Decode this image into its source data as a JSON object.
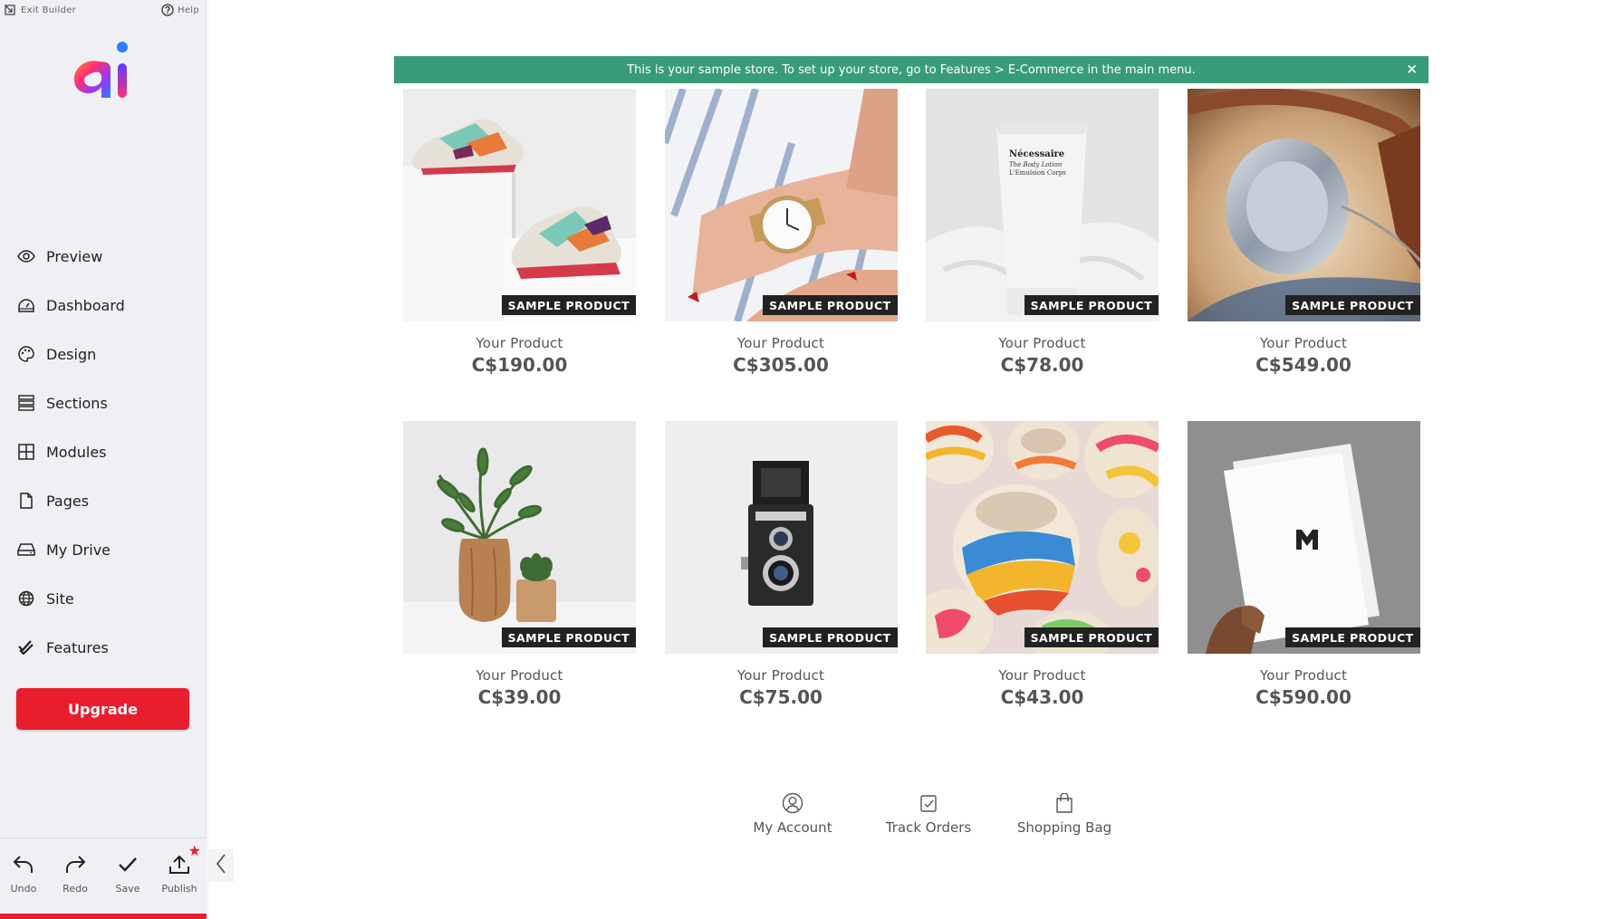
{
  "sidebar": {
    "top": {
      "exit_label": "Exit Builder",
      "help_label": "Help"
    },
    "logo_text": "ai",
    "nav": [
      {
        "label": "Preview",
        "icon": "eye-icon"
      },
      {
        "label": "Dashboard",
        "icon": "dashboard-icon"
      },
      {
        "label": "Design",
        "icon": "palette-icon"
      },
      {
        "label": "Sections",
        "icon": "sections-icon"
      },
      {
        "label": "Modules",
        "icon": "modules-icon"
      },
      {
        "label": "Pages",
        "icon": "page-icon"
      },
      {
        "label": "My Drive",
        "icon": "drive-icon"
      },
      {
        "label": "Site",
        "icon": "globe-icon"
      },
      {
        "label": "Features",
        "icon": "features-check-icon"
      }
    ],
    "upgrade_label": "Upgrade",
    "toolbar": {
      "undo": "Undo",
      "redo": "Redo",
      "save": "Save",
      "publish": "Publish"
    }
  },
  "store": {
    "banner_text": "This is your sample store. To set up your store, go to Features > E-Commerce in the main menu.",
    "close_symbol": "×",
    "badge_text": "SAMPLE PRODUCT",
    "products": [
      {
        "name": "Your Product",
        "price": "C$190.00",
        "image": "sneakers"
      },
      {
        "name": "Your Product",
        "price": "C$305.00",
        "image": "wristwatch"
      },
      {
        "name": "Your Product",
        "price": "C$78.00",
        "image": "lotion-tube"
      },
      {
        "name": "Your Product",
        "price": "C$549.00",
        "image": "headphones"
      },
      {
        "name": "Your Product",
        "price": "C$39.00",
        "image": "plants-in-vases"
      },
      {
        "name": "Your Product",
        "price": "C$75.00",
        "image": "vintage-camera"
      },
      {
        "name": "Your Product",
        "price": "C$43.00",
        "image": "painted-pottery"
      },
      {
        "name": "Your Product",
        "price": "C$590.00",
        "image": "business-cards"
      }
    ],
    "footer": [
      {
        "label": "My Account",
        "icon": "account-icon"
      },
      {
        "label": "Track Orders",
        "icon": "track-orders-icon"
      },
      {
        "label": "Shopping Bag",
        "icon": "shopping-bag-icon"
      }
    ]
  },
  "colors": {
    "brand_red": "#e81d2d",
    "banner_green": "#389c78",
    "sidebar_bg": "#f0f0f4"
  }
}
